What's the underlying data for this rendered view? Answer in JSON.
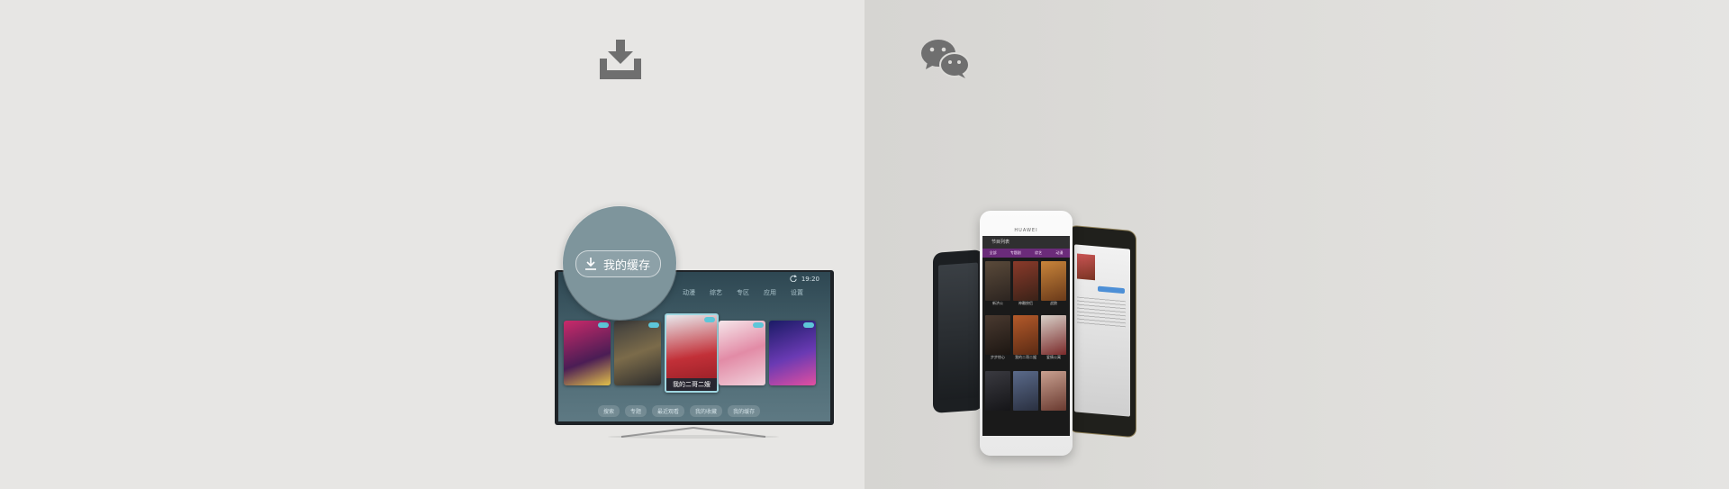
{
  "tv": {
    "time": "19:20",
    "nav": [
      "动漫",
      "综艺",
      "专区",
      "应用",
      "设置"
    ],
    "focused_title": "我的二哥二嫂",
    "bottom_bar": [
      "搜索",
      "专题",
      "最近观看",
      "我的收藏",
      "我的缓存"
    ]
  },
  "magnifier": {
    "label": "我的缓存"
  },
  "phone": {
    "brand": "HUAWEI",
    "app_title": "节目列表",
    "tabs": [
      "全部",
      "专题剧",
      "综艺",
      "动漫"
    ],
    "thumbs": [
      "新济公",
      "神雕侠侣",
      "战狼",
      "步步惊心",
      "我的二哥二嫂",
      "爱情公寓",
      "",
      "",
      ""
    ]
  },
  "colors": {
    "left_bg": "#e7e6e4",
    "right_bg": "#dcdbd8",
    "icon_gray": "#6f6f6f",
    "app_accent": "#6b2b7a",
    "tv_tag": "#5dc6d8"
  },
  "icons": [
    "download-icon",
    "wechat-icon",
    "refresh-icon",
    "search-icon",
    "tag-icon",
    "clock-icon",
    "heart-icon",
    "download-small-icon"
  ]
}
